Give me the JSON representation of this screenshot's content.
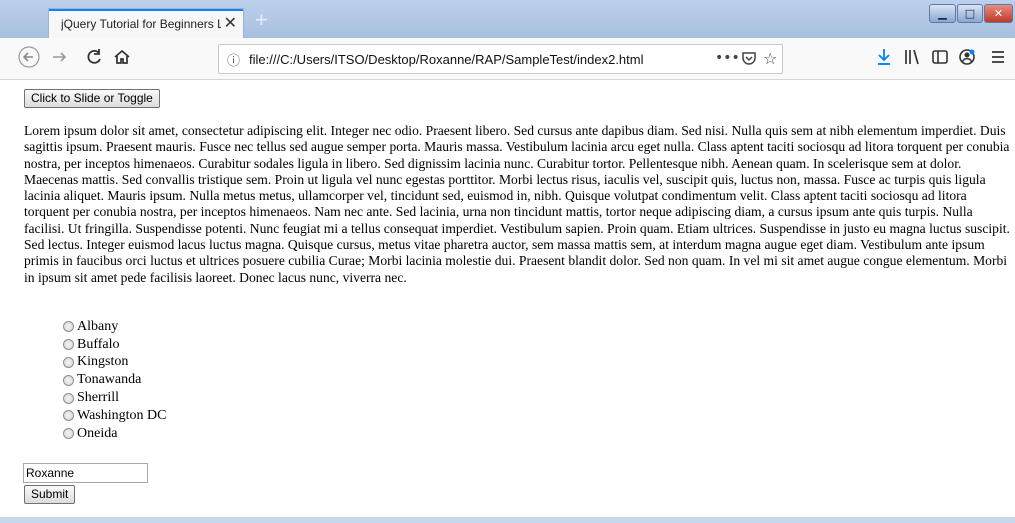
{
  "browser": {
    "tab_title": "jQuery Tutorial for Beginners Live D",
    "tab_close": "✕",
    "new_tab": "+",
    "url": "file:///C:/Users/ITSO/Desktop/Roxanne/RAP/SampleTest/index2.html",
    "icons": {
      "back": "back-arrow-icon",
      "forward": "forward-arrow-icon",
      "reload": "reload-icon",
      "home": "home-icon",
      "info": "info-icon",
      "more": "more-actions-icon",
      "pocket": "pocket-icon",
      "bookmark": "bookmark-star-icon",
      "download": "download-icon",
      "library": "library-icon",
      "sidebar": "sidebar-icon",
      "account": "account-icon",
      "menu": "hamburger-menu-icon"
    },
    "accent_color": "#0a84ff",
    "download_color": "#0a84ff"
  },
  "page": {
    "toggle_button": "Click to Slide or Toggle",
    "paragraph": "Lorem ipsum dolor sit amet, consectetur adipiscing elit. Integer nec odio. Praesent libero. Sed cursus ante dapibus diam. Sed nisi. Nulla quis sem at nibh elementum imperdiet. Duis sagittis ipsum. Praesent mauris. Fusce nec tellus sed augue semper porta. Mauris massa. Vestibulum lacinia arcu eget nulla. Class aptent taciti sociosqu ad litora torquent per conubia nostra, per inceptos himenaeos. Curabitur sodales ligula in libero. Sed dignissim lacinia nunc. Curabitur tortor. Pellentesque nibh. Aenean quam. In scelerisque sem at dolor. Maecenas mattis. Sed convallis tristique sem. Proin ut ligula vel nunc egestas porttitor. Morbi lectus risus, iaculis vel, suscipit quis, luctus non, massa. Fusce ac turpis quis ligula lacinia aliquet. Mauris ipsum. Nulla metus metus, ullamcorper vel, tincidunt sed, euismod in, nibh. Quisque volutpat condimentum velit. Class aptent taciti sociosqu ad litora torquent per conubia nostra, per inceptos himenaeos. Nam nec ante. Sed lacinia, urna non tincidunt mattis, tortor neque adipiscing diam, a cursus ipsum ante quis turpis. Nulla facilisi. Ut fringilla. Suspendisse potenti. Nunc feugiat mi a tellus consequat imperdiet. Vestibulum sapien. Proin quam. Etiam ultrices. Suspendisse in justo eu magna luctus suscipit. Sed lectus. Integer euismod lacus luctus magna. Quisque cursus, metus vitae pharetra auctor, sem massa mattis sem, at interdum magna augue eget diam. Vestibulum ante ipsum primis in faucibus orci luctus et ultrices posuere cubilia Curae; Morbi lacinia molestie dui. Praesent blandit dolor. Sed non quam. In vel mi sit amet augue congue elementum. Morbi in ipsum sit amet pede facilisis laoreet. Donec lacus nunc, viverra nec.",
    "cities": [
      "Albany",
      "Buffalo",
      "Kingston",
      "Tonawanda",
      "Sherrill",
      "Washington DC",
      "Oneida"
    ],
    "name_input_value": "Roxanne",
    "submit_button": "Submit"
  }
}
